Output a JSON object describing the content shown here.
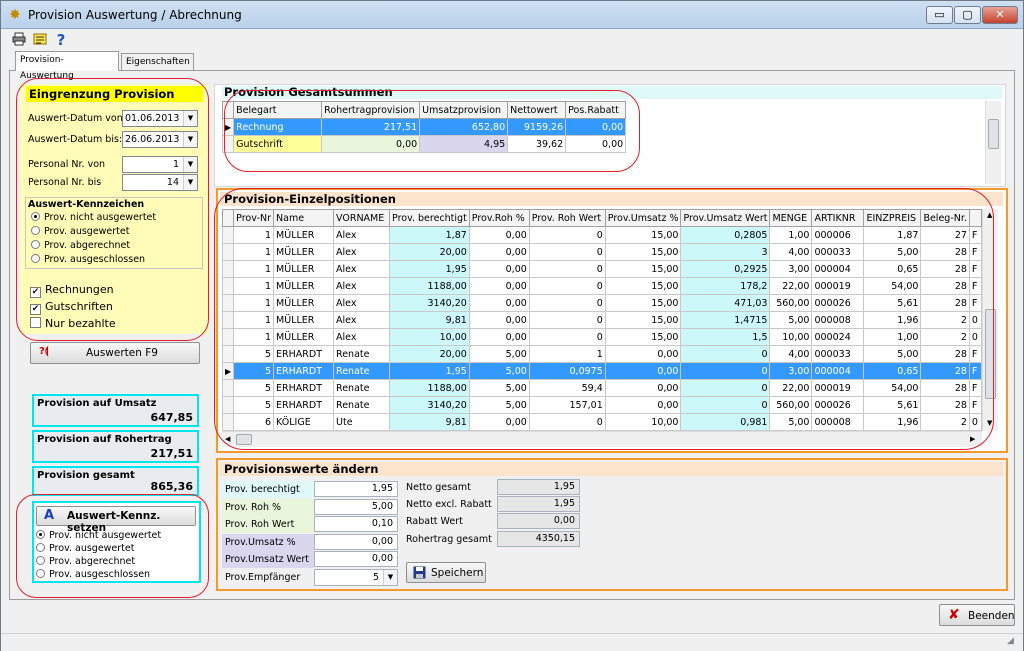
{
  "window": {
    "title": "Provision Auswertung / Abrechnung",
    "buttons": {
      "minimize": "▭",
      "maximize": "▢",
      "close": "✕"
    }
  },
  "toolbar": {
    "icons": [
      "printer-icon",
      "settings-list-icon",
      "help-icon"
    ],
    "help_glyph": "?"
  },
  "tabs": [
    {
      "label": "Provision-Auswertung",
      "active": true
    },
    {
      "label": "Eigenschaften",
      "active": false
    }
  ],
  "filter": {
    "title": "Eingrenzung Provision",
    "date_from_label": "Auswert-Datum von:",
    "date_from": "01.06.2013",
    "date_to_label": "Auswert-Datum bis:",
    "date_to": "26.06.2013",
    "personal_from_label": "Personal Nr. von",
    "personal_from": "1",
    "personal_to_label": "Personal Nr. bis",
    "personal_to": "14",
    "kennzeichen_title": "Auswert-Kennzeichen",
    "kennzeichen_options": [
      "Prov. nicht ausgewertet",
      "Prov. ausgewertet",
      "Prov. abgerechnet",
      "Prov. ausgeschlossen"
    ],
    "kennzeichen_selected": 0,
    "checks": [
      {
        "label": "Rechnungen",
        "checked": true
      },
      {
        "label": "Gutschriften",
        "checked": true
      },
      {
        "label": "Nur bezahlte",
        "checked": false
      }
    ],
    "evaluate_button": "Auswerten  F9",
    "check_mark": "✔"
  },
  "summary": {
    "umsatz_label": "Provision auf Umsatz",
    "umsatz_value": "647,85",
    "rohertrag_label": "Provision auf Rohertrag",
    "rohertrag_value": "217,51",
    "gesamt_label": "Provision gesamt",
    "gesamt_value": "865,36"
  },
  "set_flag": {
    "button": "Auswert-Kennz. setzen",
    "options": [
      "Prov. nicht ausgewertet",
      "Prov. ausgewertet",
      "Prov. abgerechnet",
      "Prov. ausgeschlossen"
    ],
    "selected": 0
  },
  "totals": {
    "title": "Provision Gesamtsummen",
    "columns": [
      "Belegart",
      "Rohertragprovision",
      "Umsatzprovision",
      "Nettowert",
      "Pos.Rabatt"
    ],
    "rows": [
      [
        "Rechnung",
        "217,51",
        "652,80",
        "9159,26",
        "0,00"
      ],
      [
        "Gutschrift",
        "0,00",
        "4,95",
        "39,62",
        "0,00"
      ]
    ]
  },
  "positions": {
    "title": "Provision-Einzelpositionen",
    "columns": [
      "Prov-Nr",
      "Name",
      "VORNAME",
      "Prov. berechtigt",
      "Prov.Roh %",
      "Prov. Roh Wert",
      "Prov.Umsatz %",
      "Prov.Umsatz Wert",
      "MENGE",
      "ARTIKNR",
      "EINZPREIS",
      "Beleg-Nr.",
      ""
    ],
    "rows": [
      [
        "1",
        "MÜLLER",
        "Alex",
        "1,87",
        "0,00",
        "0",
        "15,00",
        "0,2805",
        "1,00",
        "000006",
        "1,87",
        "27",
        "F"
      ],
      [
        "1",
        "MÜLLER",
        "Alex",
        "20,00",
        "0,00",
        "0",
        "15,00",
        "3",
        "4,00",
        "000033",
        "5,00",
        "28",
        "F"
      ],
      [
        "1",
        "MÜLLER",
        "Alex",
        "1,95",
        "0,00",
        "0",
        "15,00",
        "0,2925",
        "3,00",
        "000004",
        "0,65",
        "28",
        "F"
      ],
      [
        "1",
        "MÜLLER",
        "Alex",
        "1188,00",
        "0,00",
        "0",
        "15,00",
        "178,2",
        "22,00",
        "000019",
        "54,00",
        "28",
        "F"
      ],
      [
        "1",
        "MÜLLER",
        "Alex",
        "3140,20",
        "0,00",
        "0",
        "15,00",
        "471,03",
        "560,00",
        "000026",
        "5,61",
        "28",
        "F"
      ],
      [
        "1",
        "MÜLLER",
        "Alex",
        "9,81",
        "0,00",
        "0",
        "15,00",
        "1,4715",
        "5,00",
        "000008",
        "1,96",
        "2",
        "0"
      ],
      [
        "1",
        "MÜLLER",
        "Alex",
        "10,00",
        "0,00",
        "0",
        "15,00",
        "1,5",
        "10,00",
        "000024",
        "1,00",
        "2",
        "0"
      ],
      [
        "5",
        "ERHARDT",
        "Renate",
        "20,00",
        "5,00",
        "1",
        "0,00",
        "0",
        "4,00",
        "000033",
        "5,00",
        "28",
        "F"
      ],
      [
        "5",
        "ERHARDT",
        "Renate",
        "1,95",
        "5,00",
        "0,0975",
        "0,00",
        "0",
        "3,00",
        "000004",
        "0,65",
        "28",
        "F"
      ],
      [
        "5",
        "ERHARDT",
        "Renate",
        "1188,00",
        "5,00",
        "59,4",
        "0,00",
        "0",
        "22,00",
        "000019",
        "54,00",
        "28",
        "F"
      ],
      [
        "5",
        "ERHARDT",
        "Renate",
        "3140,20",
        "5,00",
        "157,01",
        "0,00",
        "0",
        "560,00",
        "000026",
        "5,61",
        "28",
        "F"
      ],
      [
        "6",
        "KÖLIGE",
        "Ute",
        "9,81",
        "0,00",
        "0",
        "10,00",
        "0,981",
        "5,00",
        "000008",
        "1,96",
        "2",
        "0"
      ]
    ],
    "selected_row": 8
  },
  "edit": {
    "title": "Provisionswerte ändern",
    "fields": [
      {
        "label": "Prov. berechtigt",
        "value": "1,95"
      },
      {
        "label": "Prov. Roh %",
        "value": "5,00"
      },
      {
        "label": "Prov. Roh Wert",
        "value": "0,10"
      },
      {
        "label": "Prov.Umsatz %",
        "value": "0,00"
      },
      {
        "label": "Prov.Umsatz Wert",
        "value": "0,00"
      },
      {
        "label": "Prov.Empfänger",
        "value": "5"
      }
    ],
    "netto_gesamt_label": "Netto gesamt",
    "netto_gesamt": "1,95",
    "netto_excl_label": "Netto excl. Rabatt",
    "netto_excl": "1,95",
    "rabatt_label": "Rabatt Wert",
    "rabatt": "0,00",
    "rohertrag_label": "Rohertrag gesamt",
    "rohertrag": "4350,15",
    "save_button": "Speichern"
  },
  "footer": {
    "close_button": "Beenden"
  },
  "colors": {
    "accent_yellow": "#ffff00",
    "cyan": "#00e5ee",
    "orange": "#f39a2b",
    "annotation_red": "#e0202a",
    "selection": "#3399ff"
  }
}
